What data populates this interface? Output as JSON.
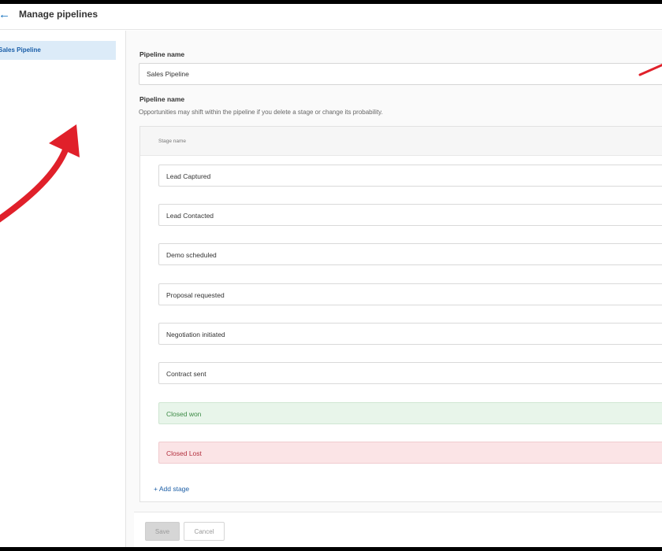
{
  "header": {
    "title": "Manage pipelines",
    "back_icon": "arrow-left-icon"
  },
  "sidebar": {
    "items": [
      {
        "label": "Sales Pipeline"
      }
    ]
  },
  "form": {
    "pipeline_name_label": "Pipeline name",
    "pipeline_name_value": "Sales Pipeline",
    "stages_label": "Pipeline name",
    "help_text": "Opportunities may shift within the pipeline if you delete a stage or change its probability.",
    "stage_column_header": "Stage name",
    "stages": [
      {
        "name": "Lead Captured",
        "status": "normal"
      },
      {
        "name": "Lead Contacted",
        "status": "normal"
      },
      {
        "name": "Demo scheduled",
        "status": "normal"
      },
      {
        "name": "Proposal requested",
        "status": "normal"
      },
      {
        "name": "Negotiation initiated",
        "status": "normal"
      },
      {
        "name": "Contract sent",
        "status": "normal"
      },
      {
        "name": "Closed won",
        "status": "won"
      },
      {
        "name": "Closed Lost",
        "status": "lost"
      }
    ],
    "add_stage_label": "+ Add stage"
  },
  "footer": {
    "save_label": "Save",
    "cancel_label": "Cancel"
  },
  "colors": {
    "accent": "#1a5ea8",
    "selected_bg": "#dcebf8",
    "won_bg": "#e8f5ea",
    "lost_bg": "#fbe4e6",
    "annotation_arrow": "#e0202a"
  }
}
